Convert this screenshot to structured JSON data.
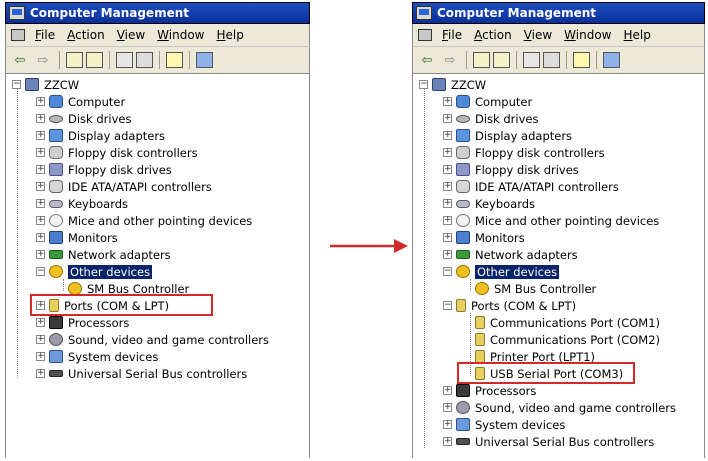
{
  "left_window": {
    "title": "Computer Management",
    "menu": [
      {
        "key": "F",
        "rest": "ile"
      },
      {
        "key": "A",
        "rest": "ction"
      },
      {
        "key": "V",
        "rest": "iew"
      },
      {
        "key": "W",
        "rest": "indow"
      },
      {
        "key": "H",
        "rest": "elp"
      }
    ],
    "root": "ZZCW",
    "items": [
      "Computer",
      "Disk drives",
      "Display adapters",
      "Floppy disk controllers",
      "Floppy disk drives",
      "IDE ATA/ATAPI controllers",
      "Keyboards",
      "Mice and other pointing devices",
      "Monitors",
      "Network adapters",
      "Other devices",
      "SM Bus Controller",
      "Ports (COM & LPT)",
      "Processors",
      "Sound, video and game controllers",
      "System devices",
      "Universal Serial Bus controllers"
    ]
  },
  "right_window": {
    "title": "Computer Management",
    "menu": [
      {
        "key": "F",
        "rest": "ile"
      },
      {
        "key": "A",
        "rest": "ction"
      },
      {
        "key": "V",
        "rest": "iew"
      },
      {
        "key": "W",
        "rest": "indow"
      },
      {
        "key": "H",
        "rest": "elp"
      }
    ],
    "root": "ZZCW",
    "items": [
      "Computer",
      "Disk drives",
      "Display adapters",
      "Floppy disk controllers",
      "Floppy disk drives",
      "IDE ATA/ATAPI controllers",
      "Keyboards",
      "Mice and other pointing devices",
      "Monitors",
      "Network adapters",
      "Other devices",
      "SM Bus Controller",
      "Ports (COM & LPT)",
      "Communications Port (COM1)",
      "Communications Port (COM2)",
      "Printer Port (LPT1)",
      "USB Serial Port (COM3)",
      "Processors",
      "Sound, video and game controllers",
      "System devices",
      "Universal Serial Bus controllers"
    ]
  },
  "colors": {
    "highlight": "#d02a2a",
    "selection": "#0a246a",
    "titlebar": "#0a2f9a"
  }
}
